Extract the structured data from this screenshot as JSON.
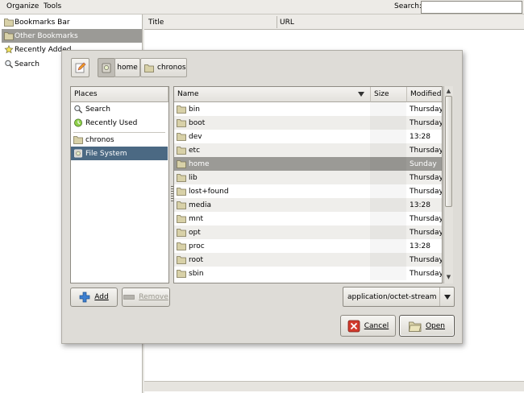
{
  "menubar": {
    "organize": "Organize",
    "tools": "Tools",
    "search_label": "Search:"
  },
  "library": {
    "items": [
      {
        "label": "Bookmarks Bar",
        "icon": "folder-icon"
      },
      {
        "label": "Other Bookmarks",
        "icon": "folder-icon"
      },
      {
        "label": "Recently Added",
        "icon": "star-icon"
      },
      {
        "label": "Search",
        "icon": "search-icon"
      }
    ],
    "columns": {
      "title": "Title",
      "url": "URL"
    }
  },
  "dialog": {
    "path": [
      "home",
      "chronos"
    ],
    "places_header": "Places",
    "places": [
      {
        "label": "Search",
        "icon": "search-icon"
      },
      {
        "label": "Recently Used",
        "icon": "clock-icon"
      },
      {
        "label": "chronos",
        "icon": "folder-icon"
      },
      {
        "label": "File System",
        "icon": "drive-icon"
      }
    ],
    "columns": {
      "name": "Name",
      "size": "Size",
      "modified": "Modified"
    },
    "files": [
      {
        "name": "bin",
        "modified": "Thursday"
      },
      {
        "name": "boot",
        "modified": "Thursday"
      },
      {
        "name": "dev",
        "modified": "13:28"
      },
      {
        "name": "etc",
        "modified": "Thursday"
      },
      {
        "name": "home",
        "modified": "Sunday"
      },
      {
        "name": "lib",
        "modified": "Thursday"
      },
      {
        "name": "lost+found",
        "modified": "Thursday"
      },
      {
        "name": "media",
        "modified": "13:28"
      },
      {
        "name": "mnt",
        "modified": "Thursday"
      },
      {
        "name": "opt",
        "modified": "Thursday"
      },
      {
        "name": "proc",
        "modified": "13:28"
      },
      {
        "name": "root",
        "modified": "Thursday"
      },
      {
        "name": "sbin",
        "modified": "Thursday"
      }
    ],
    "add_label": "Add",
    "remove_label": "Remove",
    "filter": "application/octet-stream",
    "cancel_label": "Cancel",
    "open_label": "Open"
  },
  "colors": {
    "selection_places": "#4b6983",
    "selection_files": "#9b9a96",
    "folder": "#d8d1a8"
  }
}
